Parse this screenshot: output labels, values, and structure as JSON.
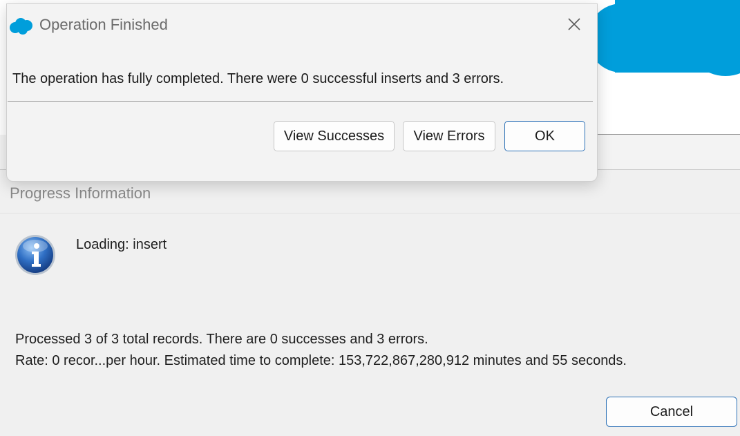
{
  "dialog": {
    "title": "Operation Finished",
    "message": "The operation has fully completed.  There were 0 successful inserts and 3 errors.",
    "buttons": {
      "view_successes": "View Successes",
      "view_errors": "View Errors",
      "ok": "OK"
    },
    "icons": {
      "logo": "salesforce-cloud-icon",
      "close": "close-icon"
    }
  },
  "progress": {
    "header": "Progress Information",
    "loading_label": "Loading: insert",
    "processed_text": "Processed 3 of 3 total records. There are 0 successes and 3 errors.",
    "rate_text": "Rate: 0 recor...per hour. Estimated time to complete: 153,722,867,280,912 minutes and 55 seconds.",
    "cancel_label": "Cancel",
    "icons": {
      "status": "info-icon"
    }
  },
  "colors": {
    "brand_cloud": "#009edb",
    "accent_border": "#2a6fb5",
    "info_icon_blue": "#1e5fb0"
  }
}
